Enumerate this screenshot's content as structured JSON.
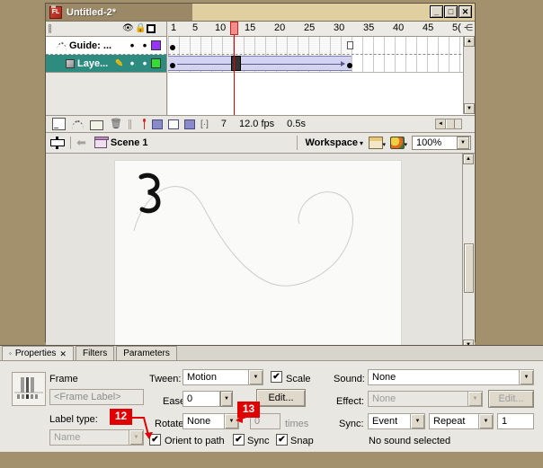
{
  "window": {
    "title": "Untitled-2*",
    "app_icon": "flash-icon",
    "buttons": {
      "minimize": "_",
      "maximize": "□",
      "close": "✕"
    }
  },
  "timeline": {
    "column_icons": {
      "eye": "eye-icon",
      "lock": "lock-icon",
      "outline": "outline-icon"
    },
    "layers": [
      {
        "name": "Guide: ...",
        "icon": "motion-guide-icon",
        "visible_dot": "•",
        "lock_dot": "•",
        "color": "#9933ff",
        "selected": false
      },
      {
        "name": "Laye...",
        "icon": "layer-icon",
        "visible_dot": "•",
        "lock_dot": "•",
        "color": "#33dd33",
        "selected": true,
        "editing": true
      }
    ],
    "ruler_labels": [
      "1",
      "5",
      "10",
      "15",
      "20",
      "25",
      "30",
      "35",
      "40",
      "45",
      "5("
    ],
    "playhead_frame": "7",
    "status": {
      "current_frame": "7",
      "fps": "12.0 fps",
      "elapsed": "0.5s",
      "icons": [
        "new-layer-icon",
        "add-motion-guide-icon",
        "new-folder-icon",
        "delete-layer-icon",
        "center-frame-icon",
        "onion-skin-icon",
        "onion-skin-outlines-icon",
        "edit-multiple-frames-icon",
        "modify-onion-markers-icon"
      ]
    }
  },
  "editbar": {
    "symbol_icon": "edit-symbols-icon",
    "back_arrow": "back-arrow-icon",
    "scene_icon": "scene-icon",
    "scene_name": "Scene 1",
    "workspace_label": "Workspace",
    "workspace_caret": "▾",
    "edit_scene_icon": "edit-scene-icon",
    "edit_symbol_icon": "edit-symbol-icon",
    "zoom_value": "100%"
  },
  "stage": {
    "guide_path_color": "#c9c9c9",
    "object_color": "#000000",
    "description": "motion guide curve with black brush-stroke object"
  },
  "properties": {
    "tabs": [
      {
        "label": "Properties",
        "active": true,
        "closable": true
      },
      {
        "label": "Filters",
        "active": false,
        "closable": false
      },
      {
        "label": "Parameters",
        "active": false,
        "closable": false
      }
    ],
    "frame_heading": "Frame",
    "frame_label_placeholder": "<Frame Label>",
    "frame_label_value": "",
    "label_type_caption": "Label type:",
    "label_type_value": "Name",
    "tween_caption": "Tween:",
    "tween_value": "Motion",
    "scale_caption": "Scale",
    "scale_checked": true,
    "ease_caption": "Ease:",
    "ease_value": "0",
    "edit_button": "Edit...",
    "rotate_caption": "Rotate:",
    "rotate_value": "None",
    "rotate_times_value": "0",
    "times_caption": "times",
    "orient_caption": "Orient to path",
    "orient_checked": true,
    "sync_caption": "Sync",
    "sync_checked": true,
    "snap_caption": "Snap",
    "snap_checked": true,
    "sound_caption": "Sound:",
    "sound_value": "None",
    "effect_caption": "Effect:",
    "effect_value": "None",
    "effect_edit_button": "Edit...",
    "sync_row_caption": "Sync:",
    "sync_event_value": "Event",
    "sync_repeat_value": "Repeat",
    "sync_loop_count": "1",
    "no_sound_text": "No sound selected"
  },
  "annotations": [
    {
      "id": "12",
      "target": "orient-to-path-checkbox"
    },
    {
      "id": "13",
      "target": "rotate-dropdown"
    }
  ],
  "colors": {
    "desktop": "#a3906c",
    "panel": "#e8e7e2",
    "selected_layer": "#2d8b80",
    "annotation": "#e00000",
    "playhead": "#dd0000"
  }
}
